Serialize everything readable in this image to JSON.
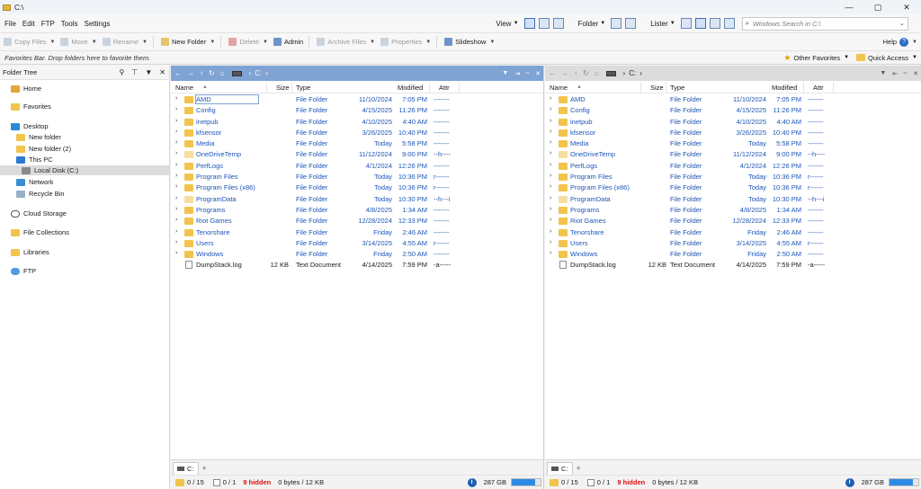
{
  "window": {
    "title": "C:\\",
    "min": "—",
    "max": "▢",
    "close": "✕"
  },
  "menu": {
    "items": [
      "File",
      "Edit",
      "FTP",
      "Tools",
      "Settings"
    ],
    "view_label": "View",
    "folder_label": "Folder",
    "lister_label": "Lister",
    "search_placeholder": "Windows Search in C:\\",
    "help_label": "Help"
  },
  "toolbar": {
    "copy": "Copy Files",
    "move": "Move",
    "rename": "Rename",
    "new_folder": "New Folder",
    "delete": "Delete",
    "admin": "Admin",
    "archive": "Archive Files",
    "properties": "Properties",
    "slideshow": "Slideshow"
  },
  "favbar": {
    "hint": "Favorites Bar. Drop folders here to favorite them.",
    "other_favorites": "Other Favorites",
    "quick_access": "Quick Access"
  },
  "tree": {
    "title": "Folder Tree",
    "nodes": [
      {
        "label": "Home",
        "icon": "home-icon"
      },
      {
        "label": "Favorites",
        "icon": "favorites-folder-icon"
      },
      {
        "label": "Desktop",
        "icon": "desktop-icon"
      },
      {
        "label": "New folder",
        "icon": "folder-icon"
      },
      {
        "label": "New folder (2)",
        "icon": "folder-icon"
      },
      {
        "label": "This PC",
        "icon": "computer-icon"
      },
      {
        "label": "Local Disk (C:)",
        "icon": "disk-icon"
      },
      {
        "label": "Network",
        "icon": "network-icon"
      },
      {
        "label": "Recycle Bin",
        "icon": "recycle-bin-icon"
      },
      {
        "label": "Cloud Storage",
        "icon": "cloud-icon"
      },
      {
        "label": "File Collections",
        "icon": "collections-icon"
      },
      {
        "label": "Libraries",
        "icon": "libraries-icon"
      },
      {
        "label": "FTP",
        "icon": "ftp-icon"
      }
    ]
  },
  "pane": {
    "path_drive": "C:",
    "columns": {
      "name": "Name",
      "size": "Size",
      "type": "Type",
      "modified": "Modified",
      "attr": "Attr"
    },
    "files": [
      {
        "name": "AMD",
        "size": "",
        "type": "File Folder",
        "date": "11/10/2024",
        "time": "7:05 PM",
        "attr": "-------",
        "kind": "folder"
      },
      {
        "name": "Config",
        "size": "",
        "type": "File Folder",
        "date": "4/15/2025",
        "time": "11:26 PM",
        "attr": "-------",
        "kind": "folder"
      },
      {
        "name": "inetpub",
        "size": "",
        "type": "File Folder",
        "date": "4/10/2025",
        "time": "4:40 AM",
        "attr": "-------",
        "kind": "folder"
      },
      {
        "name": "kfsensor",
        "size": "",
        "type": "File Folder",
        "date": "3/26/2025",
        "time": "10:40 PM",
        "attr": "-------",
        "kind": "folder"
      },
      {
        "name": "Media",
        "size": "",
        "type": "File Folder",
        "date": "Today",
        "time": "5:58 PM",
        "attr": "-------",
        "kind": "folder"
      },
      {
        "name": "OneDriveTemp",
        "size": "",
        "type": "File Folder",
        "date": "11/12/2024",
        "time": "9:00 PM",
        "attr": "--h----",
        "kind": "hidden"
      },
      {
        "name": "PerfLogs",
        "size": "",
        "type": "File Folder",
        "date": "4/1/2024",
        "time": "12:26 PM",
        "attr": "-------",
        "kind": "folder"
      },
      {
        "name": "Program Files",
        "size": "",
        "type": "File Folder",
        "date": "Today",
        "time": "10:36 PM",
        "attr": "r------",
        "kind": "folder"
      },
      {
        "name": "Program Files (x86)",
        "size": "",
        "type": "File Folder",
        "date": "Today",
        "time": "10:36 PM",
        "attr": "r------",
        "kind": "folder"
      },
      {
        "name": "ProgramData",
        "size": "",
        "type": "File Folder",
        "date": "Today",
        "time": "10:30 PM",
        "attr": "--h---i",
        "kind": "hidden"
      },
      {
        "name": "Programs",
        "size": "",
        "type": "File Folder",
        "date": "4/8/2025",
        "time": "1:34 AM",
        "attr": "-------",
        "kind": "folder"
      },
      {
        "name": "Riot Games",
        "size": "",
        "type": "File Folder",
        "date": "12/28/2024",
        "time": "12:33 PM",
        "attr": "-------",
        "kind": "folder"
      },
      {
        "name": "Tenorshare",
        "size": "",
        "type": "File Folder",
        "date": "Friday",
        "time": "2:46 AM",
        "attr": "-------",
        "kind": "folder"
      },
      {
        "name": "Users",
        "size": "",
        "type": "File Folder",
        "date": "3/14/2025",
        "time": "4:55 AM",
        "attr": "r------",
        "kind": "folder"
      },
      {
        "name": "Windows",
        "size": "",
        "type": "File Folder",
        "date": "Friday",
        "time": "2:50 AM",
        "attr": "-------",
        "kind": "folder"
      },
      {
        "name": "DumpStack.log",
        "size": "12 KB",
        "type": "Text Document",
        "date": "4/14/2025",
        "time": "7:59 PM",
        "attr": "-a-----",
        "kind": "file"
      }
    ],
    "tab_label": "C:",
    "status": {
      "folders": "0 / 15",
      "files": "0 / 1",
      "hidden": "9 hidden",
      "bytes": "0 bytes / 12 KB",
      "free": "287 GB",
      "usage_fraction": 0.82
    }
  }
}
